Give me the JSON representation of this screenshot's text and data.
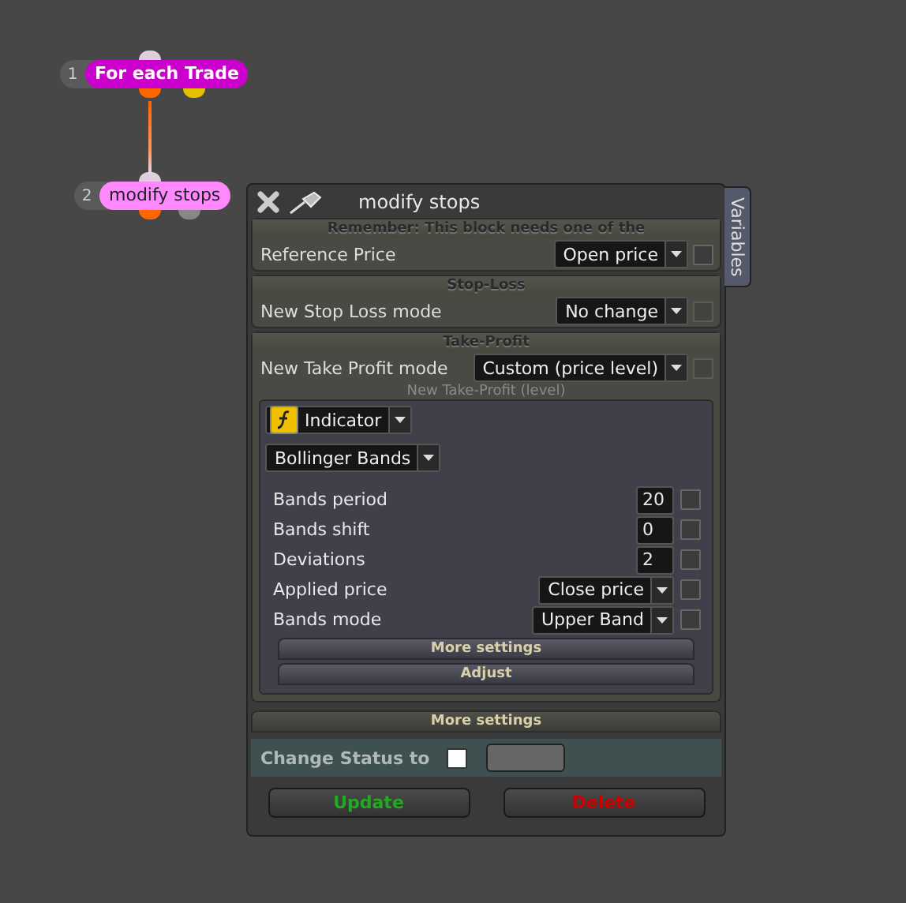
{
  "nodes": [
    {
      "number": "1",
      "label": "For each Trade",
      "color": "#cc00cc"
    },
    {
      "number": "2",
      "label": "modify stops",
      "color": "#ff88ff"
    }
  ],
  "panel": {
    "title": "modify stops",
    "side_tab": "Variables",
    "sections": [
      {
        "kind": "group",
        "header": "Remember: This block needs one of the",
        "rows": [
          {
            "label": "Reference Price",
            "value": "Open price",
            "checked": false,
            "disabled": false
          }
        ]
      },
      {
        "kind": "group",
        "header": "Stop-Loss",
        "rows": [
          {
            "label": "New Stop Loss mode",
            "value": "No change",
            "checked": false,
            "disabled": true
          }
        ]
      },
      {
        "kind": "group",
        "header": "Take-Profit",
        "rows": [
          {
            "label": "New Take Profit mode",
            "value": "Custom (price level)",
            "checked": false,
            "disabled": true
          }
        ],
        "sub": {
          "caption": "New Take-Profit (level)",
          "source": "Indicator",
          "indicator": "Bollinger Bands",
          "params": [
            {
              "kind": "number",
              "label": "Bands period",
              "value": "20",
              "checked": false
            },
            {
              "kind": "number",
              "label": "Bands shift",
              "value": "0",
              "checked": false
            },
            {
              "kind": "number",
              "label": "Deviations",
              "value": "2",
              "checked": false
            },
            {
              "kind": "select",
              "label": "Applied price",
              "value": "Close price",
              "checked": false
            },
            {
              "kind": "select",
              "label": "Bands mode",
              "value": "Upper Band",
              "checked": false
            }
          ],
          "buttons": [
            "More settings",
            "Adjust"
          ]
        }
      },
      {
        "kind": "bar",
        "label": "More settings"
      }
    ],
    "status": {
      "label": "Change Status to",
      "checked": false
    },
    "buttons": [
      {
        "label": "Update",
        "color": "#22aa22"
      },
      {
        "label": "Delete",
        "color": "#cc0000"
      }
    ]
  }
}
